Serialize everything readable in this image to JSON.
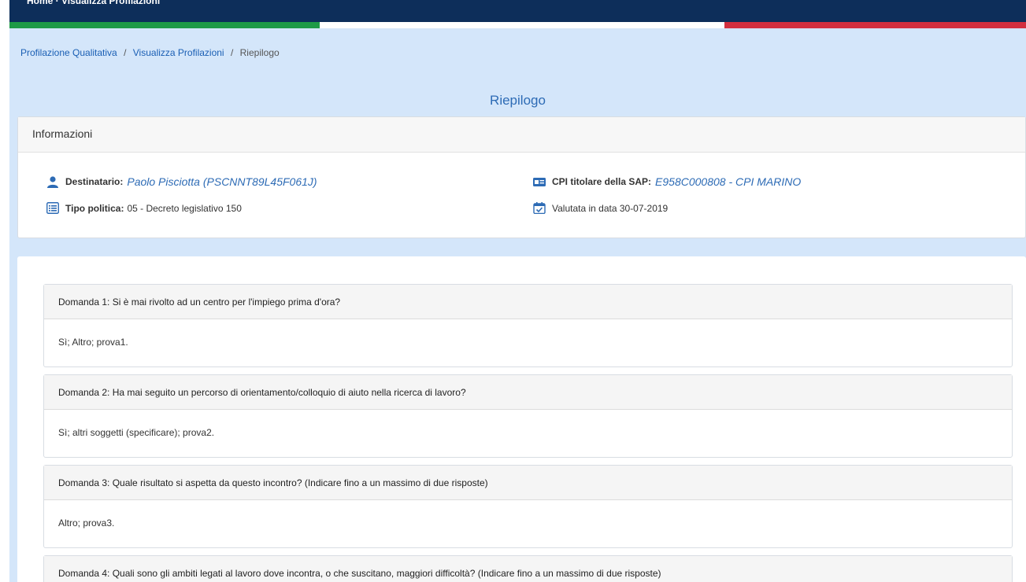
{
  "topbar": {
    "crumb": "Home · Visualizza Profilazioni"
  },
  "breadcrumb": {
    "item1": "Profilazione Qualitativa",
    "item2": "Visualizza Profilazioni",
    "current": "Riepilogo",
    "sep": "/"
  },
  "page_title": "Riepilogo",
  "info": {
    "header": "Informazioni",
    "destinatario_label": "Destinatario:",
    "destinatario_value": "Paolo Pisciotta (PSCNNT89L45F061J)",
    "tipo_label": "Tipo politica:",
    "tipo_value": "05 - Decreto legislativo 150",
    "cpi_label": "CPI titolare della SAP:",
    "cpi_value": "E958C000808 - CPI MARINO",
    "valutata": "Valutata in data 30-07-2019"
  },
  "questions": [
    {
      "q": "Domanda 1: Si è mai rivolto ad un centro per l'impiego prima d'ora?",
      "a": "Sì; Altro; prova1."
    },
    {
      "q": "Domanda 2: Ha mai seguito un percorso di orientamento/colloquio di aiuto nella ricerca di lavoro?",
      "a": "Sì; altri soggetti (specificare); prova2."
    },
    {
      "q": "Domanda 3: Quale risultato si aspetta da questo incontro? (Indicare fino a un massimo di due risposte)",
      "a": "Altro; prova3."
    },
    {
      "q": "Domanda 4: Quali sono gli ambiti legati al lavoro dove incontra, o che suscitano, maggiori difficoltà? (Indicare fino a un massimo di due risposte)",
      "a": ""
    }
  ],
  "colors": {
    "navy": "#0d2e5a",
    "green": "#1e9a46",
    "red": "#d32f3f",
    "page_bg": "#d4e6fa",
    "accent": "#2d6bb5"
  },
  "icons": {
    "destinatario": "user-icon",
    "tipo": "list-icon",
    "cpi": "id-card-icon",
    "valutata": "calendar-check-icon"
  }
}
